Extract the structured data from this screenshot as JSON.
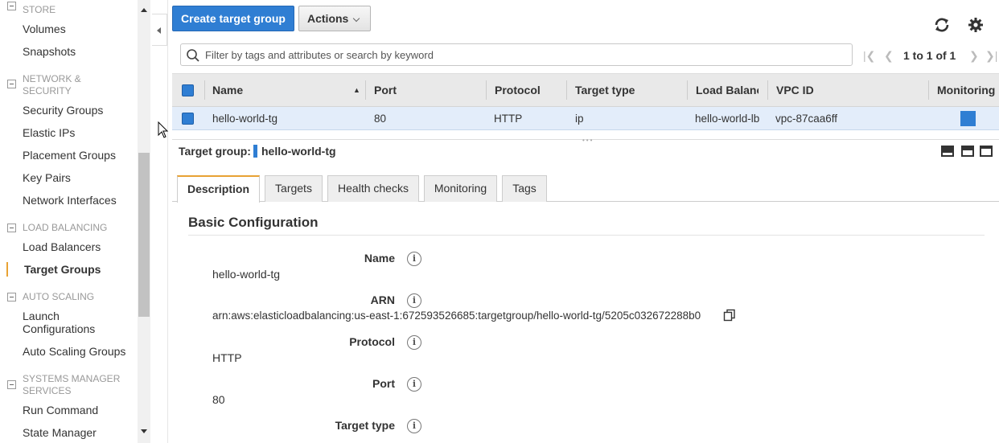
{
  "sidebar": {
    "store": {
      "header": "STORE",
      "items": [
        "Volumes",
        "Snapshots"
      ]
    },
    "network": {
      "header_line1": "NETWORK &",
      "header_line2": "SECURITY",
      "items": [
        "Security Groups",
        "Elastic IPs",
        "Placement Groups",
        "Key Pairs",
        "Network Interfaces"
      ]
    },
    "lb": {
      "header": "LOAD BALANCING",
      "items": [
        "Load Balancers",
        "Target Groups"
      ]
    },
    "autoscaling": {
      "header": "AUTO SCALING",
      "launch_line1": "Launch",
      "launch_line2": "Configurations",
      "asg": "Auto Scaling Groups"
    },
    "ssm": {
      "header_line1": "SYSTEMS MANAGER",
      "header_line2": "SERVICES",
      "items": [
        "Run Command",
        "State Manager"
      ]
    }
  },
  "toolbar": {
    "create_label": "Create target group",
    "actions_label": "Actions"
  },
  "search": {
    "placeholder": "Filter by tags and attributes or search by keyword"
  },
  "pager": {
    "label": "1 to 1 of 1"
  },
  "table": {
    "columns": [
      "Name",
      "Port",
      "Protocol",
      "Target type",
      "Load Balanc",
      "VPC ID",
      "Monitoring"
    ],
    "rows": [
      {
        "name": "hello-world-tg",
        "port": "80",
        "protocol": "HTTP",
        "target_type": "ip",
        "load_balancer": "hello-world-lb",
        "vpc_id": "vpc-87caa6ff",
        "monitoring_color": "#2f7ed3"
      }
    ]
  },
  "detail": {
    "label": "Target group:",
    "value": "hello-world-tg",
    "tabs": [
      "Description",
      "Targets",
      "Health checks",
      "Monitoring",
      "Tags"
    ],
    "section_title": "Basic Configuration",
    "fields": [
      {
        "label": "Name",
        "value": "hello-world-tg"
      },
      {
        "label": "ARN",
        "value": "arn:aws:elasticloadbalancing:us-east-1:672593526685:targetgroup/hello-world-tg/5205c032672288b0"
      },
      {
        "label": "Protocol",
        "value": "HTTP"
      },
      {
        "label": "Port",
        "value": "80"
      },
      {
        "label": "Target type",
        "value": ""
      }
    ]
  },
  "colors": {
    "accent": "#2f7ed3",
    "active_tab": "#e8a234",
    "header_bg": "#e9e9e9",
    "row_selected": "#e3edfa"
  }
}
